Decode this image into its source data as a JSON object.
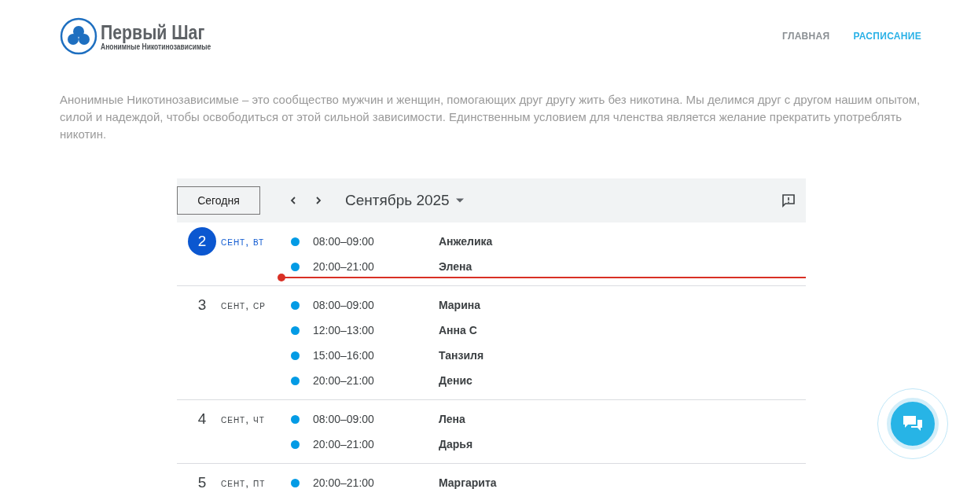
{
  "header": {
    "logo": {
      "title": "Первый Шаг",
      "subtitle": "Анонимные Никотинозависимые"
    },
    "nav": [
      {
        "label": "ГЛАВНАЯ",
        "selected": false
      },
      {
        "label": "РАСПИСАНИЕ",
        "selected": true
      }
    ]
  },
  "intro": "Анонимные Никотинозависимые – это сообщество мужчин и женщин, помогающих друг другу жить без никотина. Мы делимся друг с другом нашим опытом, силой и надеждой, чтобы освободиться от этой сильной зависимости. Единственным условием для членства является желание прекратить употреблять никотин.",
  "calendar": {
    "today_button": "Сегодня",
    "month": "Сентябрь 2025",
    "days": [
      {
        "day": "2",
        "label": "сент, вт",
        "today": true,
        "now_line": true,
        "events": [
          {
            "time": "08:00–09:00",
            "title": "Анжелика",
            "color": "#039be5"
          },
          {
            "time": "20:00–21:00",
            "title": "Элена",
            "color": "#039be5"
          }
        ]
      },
      {
        "day": "3",
        "label": "сент, ср",
        "today": false,
        "now_line": false,
        "events": [
          {
            "time": "08:00–09:00",
            "title": "Марина",
            "color": "#039be5"
          },
          {
            "time": "12:00–13:00",
            "title": "Анна С",
            "color": "#039be5"
          },
          {
            "time": "15:00–16:00",
            "title": "Танзиля",
            "color": "#039be5"
          },
          {
            "time": "20:00–21:00",
            "title": "Денис",
            "color": "#039be5"
          }
        ]
      },
      {
        "day": "4",
        "label": "сент, чт",
        "today": false,
        "now_line": false,
        "events": [
          {
            "time": "08:00–09:00",
            "title": "Лена",
            "color": "#039be5"
          },
          {
            "time": "20:00–21:00",
            "title": "Дарья",
            "color": "#039be5"
          }
        ]
      },
      {
        "day": "5",
        "label": "сент, пт",
        "today": false,
        "now_line": false,
        "events": [
          {
            "time": "20:00–21:00",
            "title": "Маргарита",
            "color": "#039be5"
          }
        ]
      }
    ]
  }
}
